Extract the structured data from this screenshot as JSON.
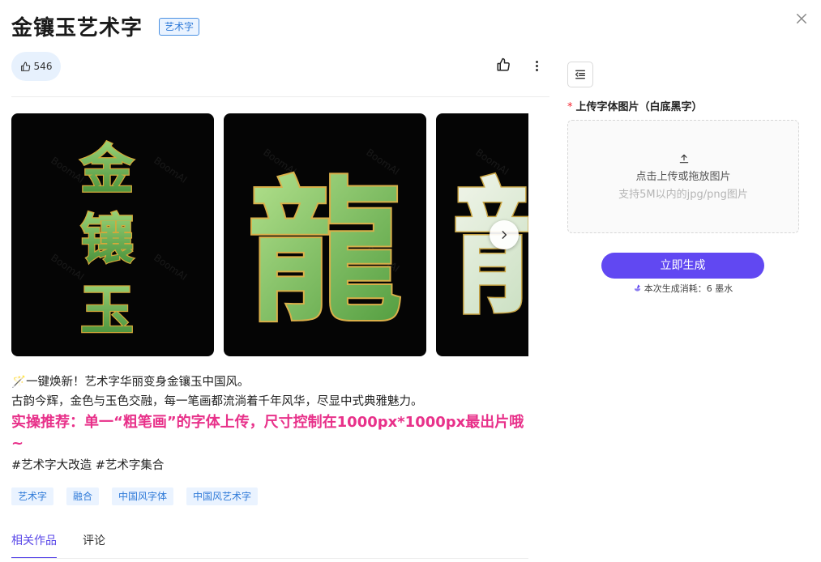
{
  "header": {
    "title": "金镶玉艺术字",
    "tag": "艺术字"
  },
  "actions": {
    "like_count": "546",
    "like_icon": "thumbs-up-icon",
    "more_icon": "more-vertical-icon"
  },
  "gallery": {
    "images": [
      {
        "alt": "金镶玉",
        "watermark": "BoomAI"
      },
      {
        "alt": "龍",
        "watermark": "BoomAI"
      },
      {
        "alt": "",
        "watermark": "BoomAI"
      }
    ],
    "next_icon": "chevron-right-icon"
  },
  "description": {
    "emoji": "🪄",
    "line1": "一键焕新！艺术字华丽变身金镶玉中国风。",
    "line2": "古韵今辉，金色与玉色交融，每一笔画都流淌着千年风华，尽显中式典雅魅力。",
    "highlight": "实操推荐：单一“粗笔画”的字体上传，尺寸控制在1000px*1000px最出片哦~",
    "hashtags": "#艺术字大改造 #艺术字集合"
  },
  "tags": [
    "艺术字",
    "融合",
    "中国风字体",
    "中国风艺术字"
  ],
  "tabs": [
    {
      "label": "相关作品",
      "active": true
    },
    {
      "label": "评论",
      "active": false
    }
  ],
  "panel": {
    "required_mark": "*",
    "upload_label": "上传字体图片（白底黑字）",
    "upload_main": "点击上传或拖放图片",
    "upload_hint": "支持5M以内的jpg/png图片",
    "generate_button": "立即生成",
    "cost_text": "本次生成消耗：6 墨水"
  },
  "colors": {
    "accent": "#6148f2",
    "highlight": "#e8318a",
    "tag_bg": "#eaf3ff",
    "tag_text": "#2f7ad8",
    "jade": "#6cae4c",
    "gold": "#d4a93a"
  }
}
